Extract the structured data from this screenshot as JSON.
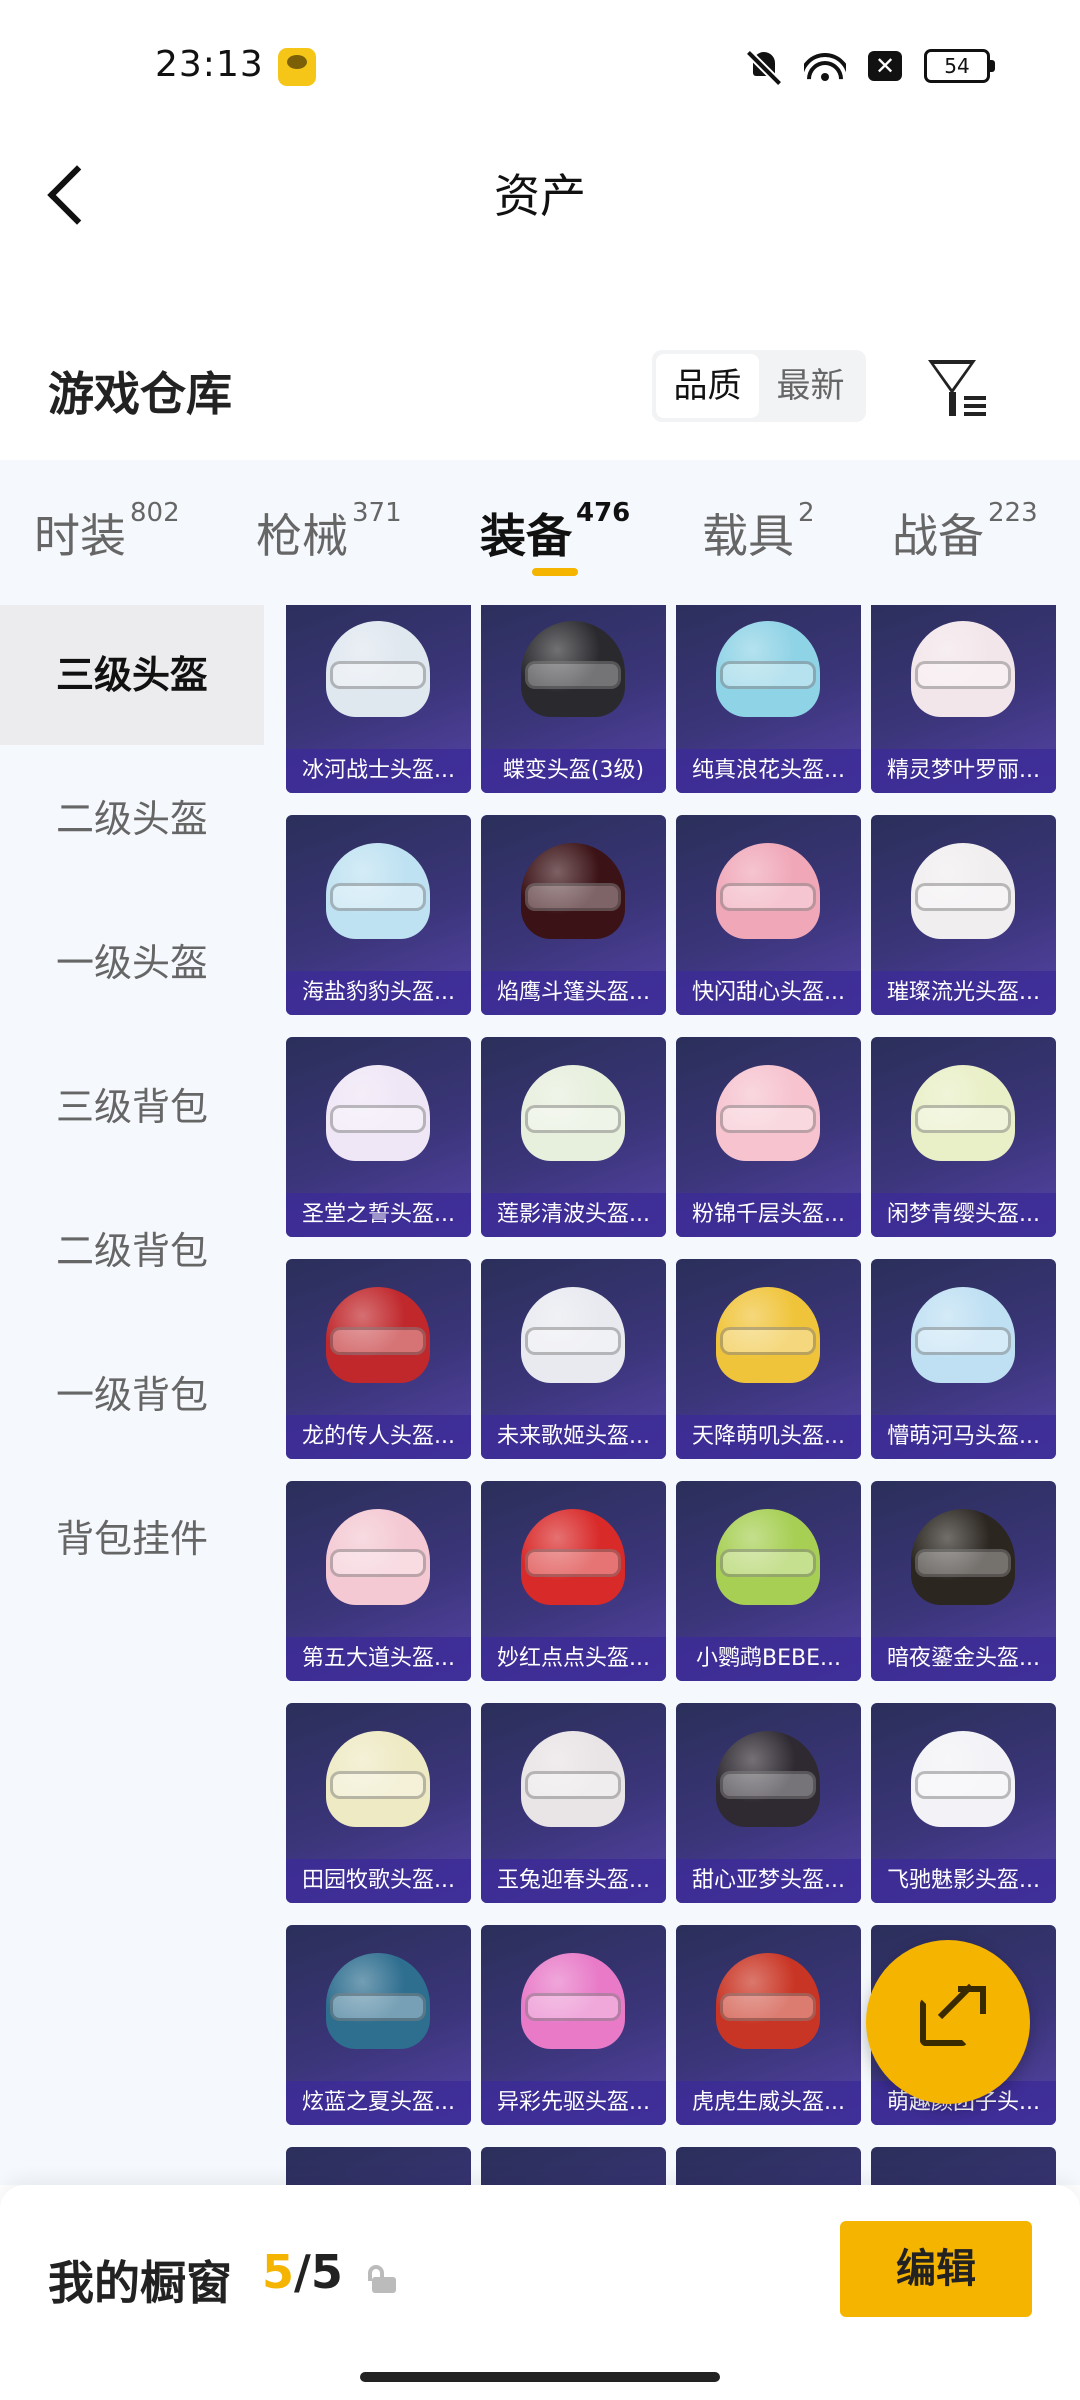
{
  "status": {
    "time": "23:13",
    "battery": "54"
  },
  "header": {
    "title": "资产"
  },
  "section": {
    "title": "游戏仓库"
  },
  "sort": {
    "options": [
      "品质",
      "最新"
    ]
  },
  "categories": [
    {
      "label": "时装",
      "count": "802"
    },
    {
      "label": "枪械",
      "count": "371"
    },
    {
      "label": "装备",
      "count": "476"
    },
    {
      "label": "载具",
      "count": "2"
    },
    {
      "label": "战备",
      "count": "223"
    }
  ],
  "sidebar": {
    "items": [
      "三级头盔",
      "二级头盔",
      "一级头盔",
      "三级背包",
      "二级背包",
      "一级背包",
      "背包挂件"
    ]
  },
  "items": [
    {
      "name": "冰河战士头盔...",
      "color": "#dfe7ef"
    },
    {
      "name": "蝶变头盔(3级)",
      "color": "#2a2a2e"
    },
    {
      "name": "纯真浪花头盔...",
      "color": "#8fd3e6"
    },
    {
      "name": "精灵梦叶罗丽...",
      "color": "#f3e6ea"
    },
    {
      "name": "海盐豹豹头盔...",
      "color": "#bfe2f2"
    },
    {
      "name": "焰鹰斗篷头盔...",
      "color": "#3b1216"
    },
    {
      "name": "快闪甜心头盔...",
      "color": "#f0a7b8"
    },
    {
      "name": "璀璨流光头盔...",
      "color": "#f1eef0"
    },
    {
      "name": "圣堂之誓头盔...",
      "color": "#efe6f6"
    },
    {
      "name": "莲影清波头盔...",
      "color": "#e7efdd"
    },
    {
      "name": "粉锦千层头盔...",
      "color": "#f6c3cf"
    },
    {
      "name": "闲梦青缨头盔...",
      "color": "#e9efc6"
    },
    {
      "name": "龙的传人头盔...",
      "color": "#c0282c"
    },
    {
      "name": "未来歌姬头盔...",
      "color": "#e9eaf0"
    },
    {
      "name": "天降萌叽头盔...",
      "color": "#f0c43a"
    },
    {
      "name": "懵萌河马头盔...",
      "color": "#bfe0f3"
    },
    {
      "name": "第五大道头盔...",
      "color": "#f4c9d3"
    },
    {
      "name": "妙红点点头盔...",
      "color": "#d92a2a"
    },
    {
      "name": "小鹦鹉BEBE...",
      "color": "#a7cf54"
    },
    {
      "name": "暗夜鎏金头盔...",
      "color": "#2b2620"
    },
    {
      "name": "田园牧歌头盔...",
      "color": "#eeeac4"
    },
    {
      "name": "玉兔迎春头盔...",
      "color": "#e9e4e6"
    },
    {
      "name": "甜心亚梦头盔...",
      "color": "#2f2a32"
    },
    {
      "name": "飞驰魅影头盔...",
      "color": "#f3f3f7"
    },
    {
      "name": "炫蓝之夏头盔...",
      "color": "#2e6e8f"
    },
    {
      "name": "异彩先驱头盔...",
      "color": "#e87ac8"
    },
    {
      "name": "虎虎生威头盔...",
      "color": "#c93524"
    },
    {
      "name": "萌趣颜团子头...",
      "color": "#f3eaf0"
    }
  ],
  "showcase": {
    "label": "我的橱窗",
    "current": "5",
    "sep": "/",
    "total": "5"
  },
  "actions": {
    "edit": "编辑"
  },
  "colors": {
    "accent": "#f5b400",
    "card_bg": "#3b357a"
  },
  "icons": [
    "back-icon",
    "filter-icon",
    "share-icon",
    "lock-icon"
  ]
}
